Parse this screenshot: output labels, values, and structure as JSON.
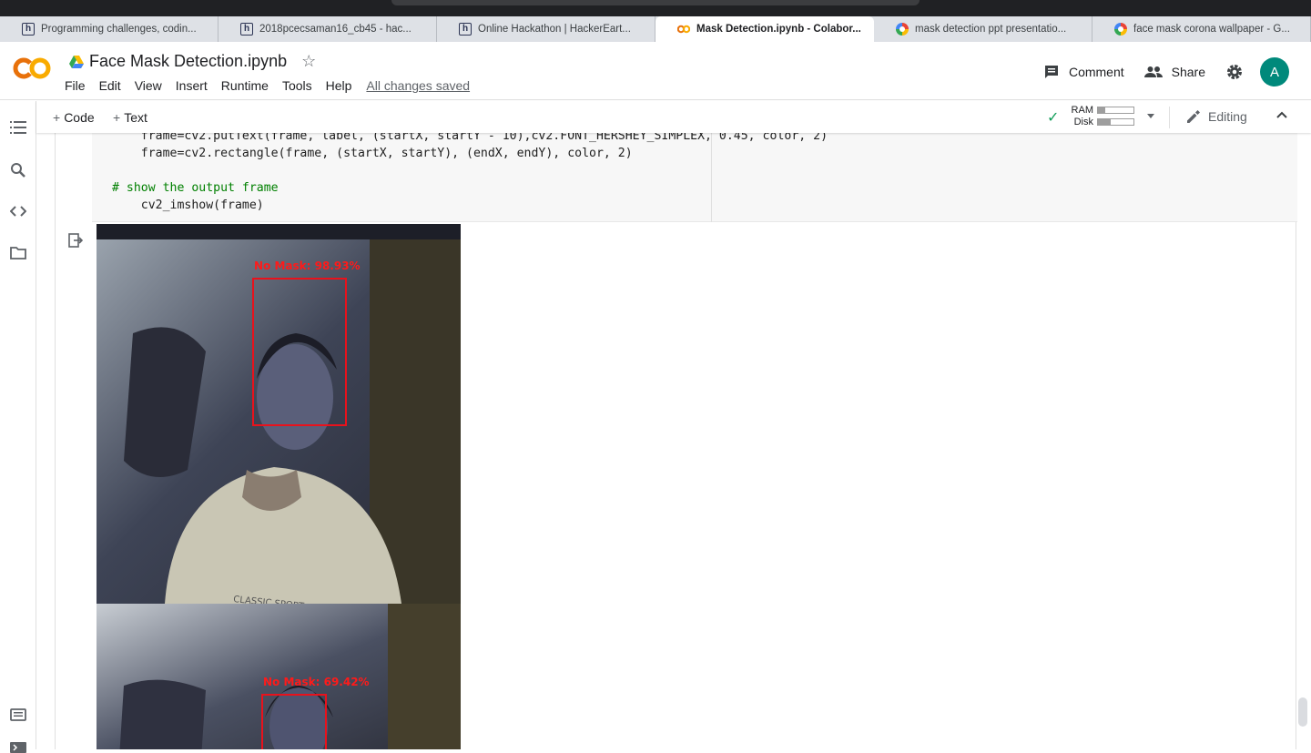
{
  "browser": {
    "tabs": [
      {
        "label": "Programming challenges, codin...",
        "favicon": "hackerearth-icon",
        "active": false
      },
      {
        "label": "2018pcecsaman16_cb45 - hac...",
        "favicon": "hackerearth-icon",
        "active": false
      },
      {
        "label": "Online Hackathon | HackerEart...",
        "favicon": "hackerearth-icon",
        "active": false
      },
      {
        "label": "Mask Detection.ipynb - Colabor...",
        "favicon": "colab-icon",
        "active": true
      },
      {
        "label": "mask detection ppt presentatio...",
        "favicon": "google-icon",
        "active": false
      },
      {
        "label": "face mask corona wallpaper - G...",
        "favicon": "google-icon",
        "active": false
      }
    ]
  },
  "header": {
    "doc_title": "Face Mask Detection.ipynb",
    "menu": [
      "File",
      "Edit",
      "View",
      "Insert",
      "Runtime",
      "Tools",
      "Help"
    ],
    "save_status": "All changes saved",
    "comment_label": "Comment",
    "share_label": "Share",
    "avatar_letter": "A",
    "avatar_color": "#00897b",
    "logo_color": "#f9ab00"
  },
  "toolbar": {
    "add_code": "Code",
    "add_text": "Text",
    "ram_label": "RAM",
    "disk_label": "Disk",
    "ram_usage": 0.2,
    "disk_usage": 0.35,
    "editing_label": "Editing"
  },
  "cell": {
    "code_lines": [
      "    frame=cv2.putText(frame, label, (startX, startY - 10),cv2.FONT_HERSHEY_SIMPLEX, 0.45, color, 2)",
      "    frame=cv2.rectangle(frame, (startX, startY), (endX, endY), color, 2)",
      "",
      "# show the output frame",
      "    cv2_imshow(frame)"
    ]
  },
  "outputs": [
    {
      "label": "No Mask: 98.93%",
      "box_color": "#e8121c"
    },
    {
      "label": "No Mask: 69.42%",
      "box_color": "#e8121c"
    }
  ]
}
